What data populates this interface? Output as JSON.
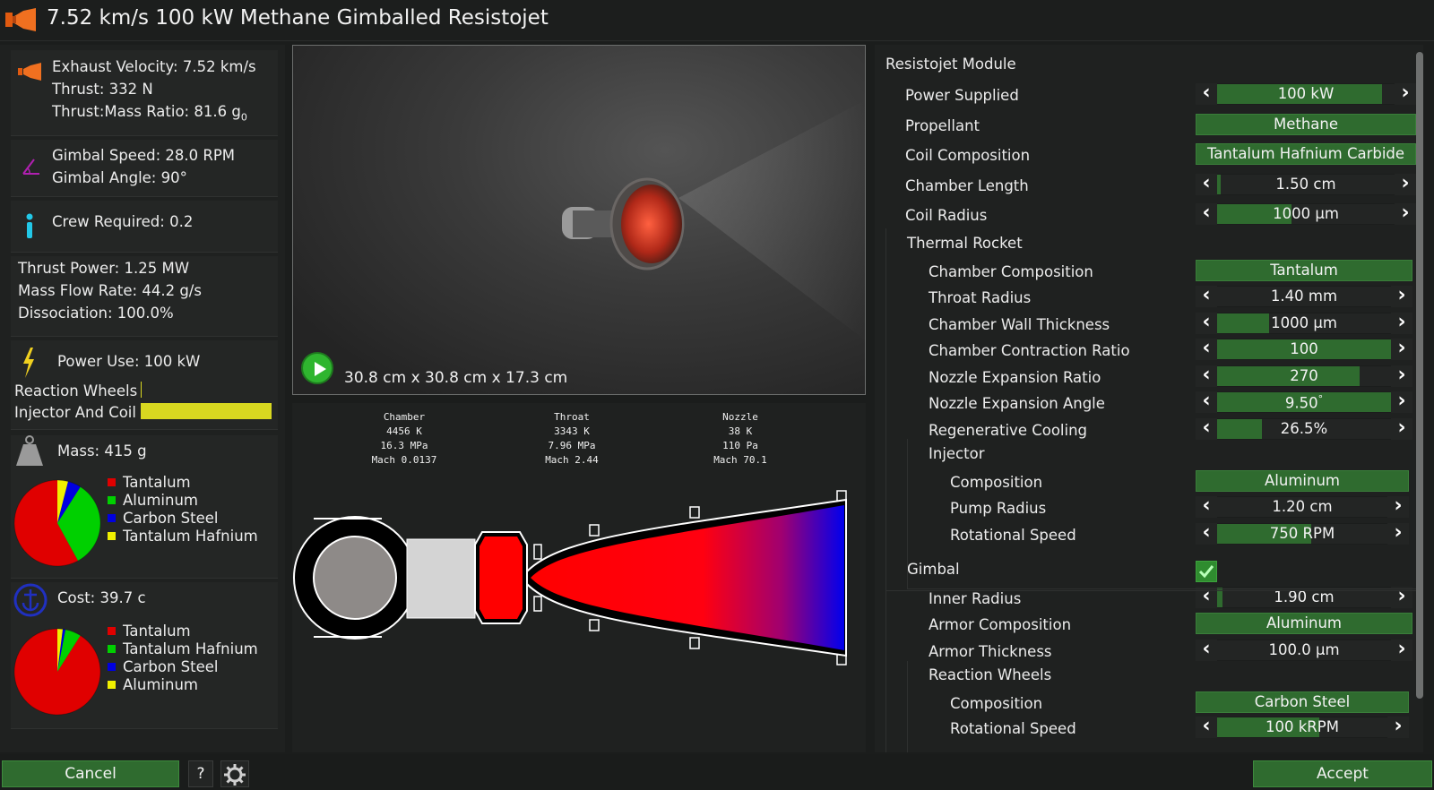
{
  "title": "7.52 km/s 100 kW Methane Gimballed Resistojet",
  "stats": {
    "exhaust_velocity": "Exhaust Velocity: 7.52 km/s",
    "thrust": "Thrust: 332 N",
    "thrust_mass_ratio": "Thrust:Mass Ratio: 81.6 g",
    "thrust_mass_ratio_sub": "0",
    "gimbal_speed": "Gimbal Speed: 28.0 RPM",
    "gimbal_angle": "Gimbal Angle: 90°",
    "crew_required": "Crew Required: 0.2",
    "thrust_power": "Thrust Power: 1.25 MW",
    "mass_flow_rate": "Mass Flow Rate: 44.2 g/s",
    "dissociation": "Dissociation: 100.0%",
    "power_use": "Power Use: 100 kW",
    "power_bars": [
      {
        "label": "Reaction Wheels",
        "fraction": 0.0
      },
      {
        "label": "Injector And Coil",
        "fraction": 1.0
      }
    ]
  },
  "mass": {
    "label": "Mass: 415 g",
    "legend": [
      "Tantalum",
      "Aluminum",
      "Carbon Steel",
      "Tantalum Hafnium Ca"
    ],
    "colors": [
      "#e00000",
      "#00d000",
      "#0000e0",
      "#f0f000"
    ],
    "fractions": [
      0.58,
      0.33,
      0.05,
      0.04
    ]
  },
  "cost": {
    "label": "Cost: 39.7 c",
    "legend": [
      "Tantalum",
      "Tantalum Hafnium Ca",
      "Carbon Steel",
      "Aluminum"
    ],
    "colors": [
      "#e00000",
      "#00d000",
      "#0000e0",
      "#f0f000"
    ],
    "fractions": [
      0.91,
      0.06,
      0.01,
      0.02
    ]
  },
  "viewport": {
    "dimensions": "30.8 cm x 30.8 cm x 17.3 cm"
  },
  "flow": [
    {
      "name": "Chamber",
      "temp": "4456 K",
      "pressure": "16.3 MPa",
      "mach": "Mach 0.0137"
    },
    {
      "name": "Throat",
      "temp": "3343 K",
      "pressure": "7.96 MPa",
      "mach": "Mach 2.44"
    },
    {
      "name": "Nozzle",
      "temp": "38 K",
      "pressure": "110 Pa",
      "mach": "Mach 70.1"
    }
  ],
  "panel": {
    "module_title": "Resistojet Module",
    "rows": {
      "power_supplied": {
        "label": "Power Supplied",
        "value": "100 kW",
        "fill": 0.93
      },
      "propellant": {
        "label": "Propellant",
        "value": "Methane"
      },
      "coil_composition": {
        "label": "Coil Composition",
        "value": "Tantalum Hafnium Carbide"
      },
      "chamber_length": {
        "label": "Chamber Length",
        "value": "1.50 cm",
        "fill": 0.02
      },
      "coil_radius": {
        "label": "Coil Radius",
        "value": "1000 μm",
        "fill": 0.42
      },
      "thermal_rocket": "Thermal Rocket",
      "chamber_composition": {
        "label": "Chamber Composition",
        "value": "Tantalum"
      },
      "throat_radius": {
        "label": "Throat Radius",
        "value": "1.40 mm",
        "fill": 0.0
      },
      "chamber_wall_thickness": {
        "label": "Chamber Wall Thickness",
        "value": "1000 μm",
        "fill": 0.3
      },
      "chamber_contraction_ratio": {
        "label": "Chamber Contraction Ratio",
        "value": "100",
        "fill": 1.0
      },
      "nozzle_expansion_ratio": {
        "label": "Nozzle Expansion Ratio",
        "value": "270",
        "fill": 0.82
      },
      "nozzle_expansion_angle": {
        "label": "Nozzle Expansion Angle",
        "value": "9.50",
        "unit": "°",
        "fill": 1.0
      },
      "regenerative_cooling": {
        "label": "Regenerative Cooling",
        "value": "26.5%",
        "fill": 0.26
      },
      "injector": "Injector",
      "injector_composition": {
        "label": "Composition",
        "value": "Aluminum"
      },
      "pump_radius": {
        "label": "Pump Radius",
        "value": "1.20 cm",
        "fill": 0.0
      },
      "rotational_speed": {
        "label": "Rotational Speed",
        "value": "750 RPM",
        "fill": 0.55
      },
      "gimbal": "Gimbal",
      "gimbal_enabled": true,
      "inner_radius": {
        "label": "Inner Radius",
        "value": "1.90 cm",
        "fill": 0.03
      },
      "armor_composition": {
        "label": "Armor Composition",
        "value": "Aluminum"
      },
      "armor_thickness": {
        "label": "Armor Thickness",
        "value": "100.0 μm",
        "fill": 0.0
      },
      "reaction_wheels": "Reaction Wheels",
      "rw_composition": {
        "label": "Composition",
        "value": "Carbon Steel"
      },
      "rw_rotational_speed": {
        "label": "Rotational Speed",
        "value": "100 kRPM",
        "fill": 0.6
      }
    }
  },
  "footer": {
    "cancel": "Cancel",
    "help": "?",
    "accept": "Accept"
  }
}
